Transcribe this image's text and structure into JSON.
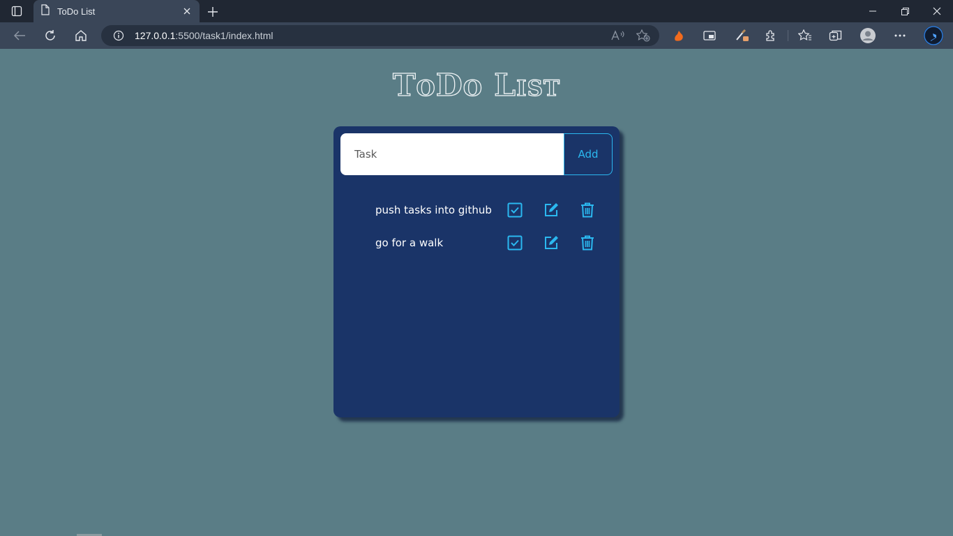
{
  "browser": {
    "tab": {
      "title": "ToDo List",
      "icon": "page-icon"
    },
    "address": {
      "host": "127.0.0.1",
      "rest": ":5500/task1/index.html"
    }
  },
  "page": {
    "title": "ToDo List",
    "input_placeholder": "Task",
    "add_label": "Add",
    "tasks": [
      {
        "text": "push tasks into github"
      },
      {
        "text": "go for a walk"
      }
    ]
  },
  "colors": {
    "page_bg": "#5a7d86",
    "card_bg": "#1a3468",
    "accent": "#2bb8f0",
    "chrome_dark": "#202733",
    "chrome_toolbar": "#3a4658"
  }
}
